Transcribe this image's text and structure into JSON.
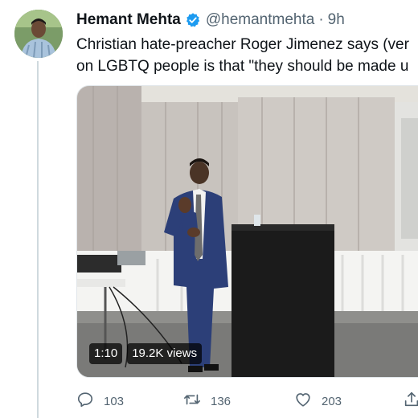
{
  "tweet": {
    "author_name": "Hemant Mehta",
    "handle": "@hemantmehta",
    "separator": "·",
    "time": "9h",
    "verified_icon": "verified-badge-icon",
    "text_lines": [
      "Christian hate-preacher Roger Jimenez says (ver",
      "on LGBTQ people is that \"they should be made u"
    ]
  },
  "media": {
    "type": "video",
    "duration": "1:10",
    "views": "19.2K views"
  },
  "actions": {
    "reply_count": "103",
    "retweet_count": "136",
    "like_count": "203",
    "icons": [
      "reply-icon",
      "retweet-icon",
      "like-icon",
      "share-icon"
    ]
  },
  "colors": {
    "verified": "#1d9bf0",
    "secondary_text": "#536471",
    "thread_line": "#cfd9de"
  }
}
